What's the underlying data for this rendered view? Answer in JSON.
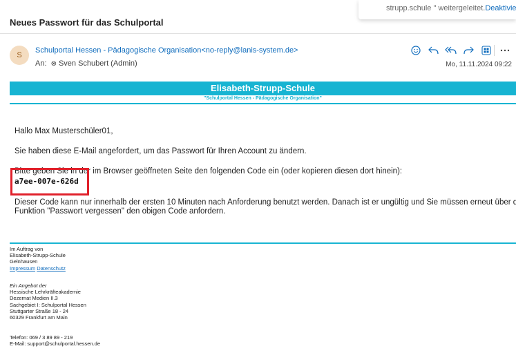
{
  "notice": {
    "text": "strupp.schule \" weitergeleitet.",
    "link": "Deaktiviere"
  },
  "subject": "Neues Passwort für das Schulportal",
  "sender": {
    "initial": "S",
    "name": "Schulportal Hessen - Pädagogische Organisation",
    "address": "<no-reply@lanis-system.de>"
  },
  "recipient": {
    "label": "An:",
    "name": "Sven Schubert (Admin)"
  },
  "date": "Mo, 11.11.2024 09:22",
  "actions": [
    "emoji-icon",
    "reply-icon",
    "reply-all-icon",
    "forward-icon",
    "apps-icon",
    "more-icon"
  ],
  "banner": {
    "title": "Elisabeth-Strupp-Schule",
    "subtitle": "\"Schulportal Hessen - Pädagogische Organisation\""
  },
  "body": {
    "greeting": "Hallo Max Musterschüler01,",
    "line1": "Sie haben diese E-Mail angefordert, um das Passwort für Ihren Account zu ändern.",
    "line2": "Bitte geben Sie in der im Browser geöffneten Seite den folgenden Code ein (oder kopieren diesen dort hinein):",
    "code": "a7ee-007e-626d",
    "line3a": "Dieser Code kann nur innerhalb der ersten 10 Minuten nach Anforderung benutzt werden. Danach ist er ungültig und Sie müssen erneut über die",
    "line3b": "Funktion \"Passwort vergessen\" den obigen Code anfordern."
  },
  "footer": {
    "block1": [
      "Im Auftrag von",
      "Elisabeth-Strupp-Schule",
      "Gelnhausen"
    ],
    "impressum": "Impressum",
    "datenschutz": "Datenschutz",
    "block2_title": "Ein Angebot der",
    "block2": [
      "Hessische Lehrkräfteakademie",
      "Dezernat Medien II.3",
      "Sachgebiet I: Schulportal Hessen",
      "Stuttgarter Straße 18 - 24",
      "60329 Frankfurt am Main"
    ],
    "block3": [
      "Telefon: 069 / 3 89 89 - 219",
      "E-Mail: support@schulportal.hessen.de"
    ]
  },
  "colors": {
    "accent": "#0f6cbd",
    "banner": "#17b4d2",
    "highlight": "#e0202a"
  }
}
